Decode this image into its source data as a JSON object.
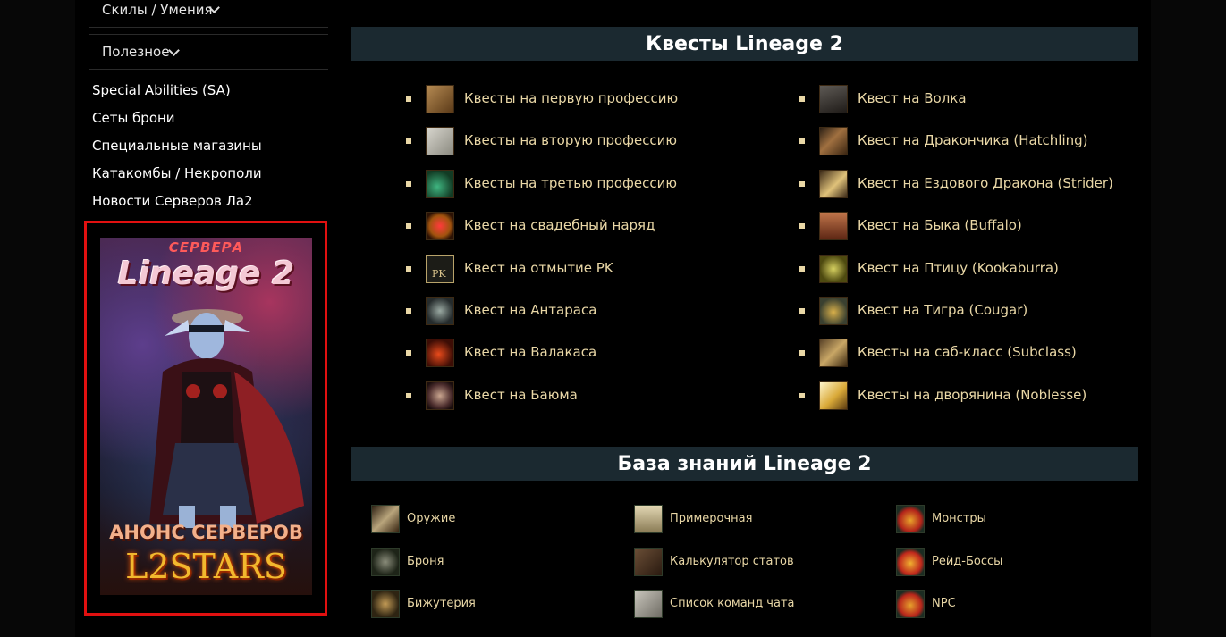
{
  "sidebar": {
    "skills_label": "Скилы / Умения",
    "useful_label": "Полезное",
    "links": [
      "Special Abilities (SA)",
      "Сеты брони",
      "Специальные магазины",
      "Катакомбы / Некрополи",
      "Новости Серверов Ла2"
    ],
    "banner": {
      "top_text": "СЕРВЕРА",
      "title": "Lineage 2",
      "announce": "АНОНС СЕРВЕРОВ",
      "brand": "L2STARS"
    }
  },
  "quests": {
    "header": "Квесты Lineage 2",
    "left": [
      {
        "label": "Квесты на первую профессию",
        "icon": "envelope-icon"
      },
      {
        "label": "Квесты на вторую профессию",
        "icon": "scroll-icon"
      },
      {
        "label": "Квесты на третью профессию",
        "icon": "green-amulet-icon"
      },
      {
        "label": "Квест на свадебный наряд",
        "icon": "heart-icon"
      },
      {
        "label": "Квест на отмытие PK",
        "icon": "pk-icon",
        "icon_text": "PK"
      },
      {
        "label": "Квест на Антараса",
        "icon": "antharas-icon"
      },
      {
        "label": "Квест на Валакаса",
        "icon": "valakas-icon"
      },
      {
        "label": "Квест на Баюма",
        "icon": "baium-icon"
      }
    ],
    "right": [
      {
        "label": "Квест на Волка",
        "icon": "collar-icon"
      },
      {
        "label": "Квест на Дракончика (Hatchling)",
        "icon": "flute-icon"
      },
      {
        "label": "Квест на Ездового Дракона (Strider)",
        "icon": "horn-icon"
      },
      {
        "label": "Квест на Быка (Buffalo)",
        "icon": "pan-pipe-icon"
      },
      {
        "label": "Квест на Птицу (Kookaburra)",
        "icon": "ocarina-icon"
      },
      {
        "label": "Квест на Тигра (Cougar)",
        "icon": "bell-icon"
      },
      {
        "label": "Квесты на саб-класс (Subclass)",
        "icon": "subclass-icon"
      },
      {
        "label": "Квесты на дворянина (Noblesse)",
        "icon": "wing-icon"
      }
    ]
  },
  "knowledge": {
    "header": "База знаний Lineage 2",
    "col1": [
      {
        "label": "Оружие",
        "icon": "sword-icon"
      },
      {
        "label": "Броня",
        "icon": "armor-icon"
      },
      {
        "label": "Бижутерия",
        "icon": "necklace-icon"
      }
    ],
    "col2": [
      {
        "label": "Примерочная",
        "icon": "robe-icon"
      },
      {
        "label": "Калькулятор статов",
        "icon": "abacus-icon"
      },
      {
        "label": "Список команд чата",
        "icon": "chat-list-icon"
      }
    ],
    "col3": [
      {
        "label": "Монстры",
        "icon": "monster-icon"
      },
      {
        "label": "Рейд-Боссы",
        "icon": "raid-boss-icon"
      },
      {
        "label": "NPC",
        "icon": "npc-icon"
      }
    ]
  }
}
